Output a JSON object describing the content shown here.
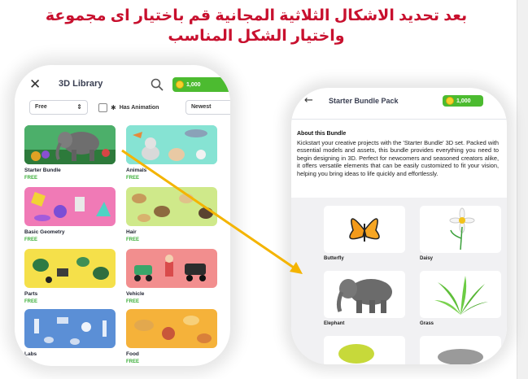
{
  "heading": {
    "line1": "بعد تحديد الاشكال الثلاثية المجانية قم باختيار اى مجموعة",
    "line2": "واختيار الشكل المناسب"
  },
  "left_phone": {
    "close_icon": "close-icon",
    "title": "3D Library",
    "search_icon": "search-icon",
    "coins": "1,000",
    "filter_price": "Free",
    "filter_animation": "Has Animation",
    "filter_sort": "Newest",
    "cards": [
      {
        "name": "Starter Bundle",
        "price": "FREE"
      },
      {
        "name": "Animals",
        "price": "FREE"
      },
      {
        "name": "Basic Geometry",
        "price": "FREE"
      },
      {
        "name": "Hair",
        "price": "FREE"
      },
      {
        "name": "Parts",
        "price": "FREE"
      },
      {
        "name": "Vehicle",
        "price": "FREE"
      },
      {
        "name": "Labs",
        "price": ""
      },
      {
        "name": "Food",
        "price": "FREE"
      }
    ]
  },
  "right_phone": {
    "back_icon": "back-arrow-icon",
    "title": "Starter Bundle Pack",
    "coins": "1,000",
    "about_title": "About this Bundle",
    "about_text": "Kickstart your creative projects with the 'Starter Bundle' 3D set. Packed with essential models and assets, this bundle provides everything you need to begin designing in 3D. Perfect for newcomers and seasoned creators alike, it offers versatile elements that can be easily customized to fit your vision, helping you bring ideas to life quickly and effortlessly.",
    "assets": [
      {
        "name": "Butterfly"
      },
      {
        "name": "Daisy"
      },
      {
        "name": "Elephant"
      },
      {
        "name": "Grass"
      }
    ]
  },
  "colors": {
    "heading": "#c8102e",
    "coin_badge": "#4cbb30",
    "free_label": "#3cae3a",
    "arrow": "#f4b400"
  }
}
